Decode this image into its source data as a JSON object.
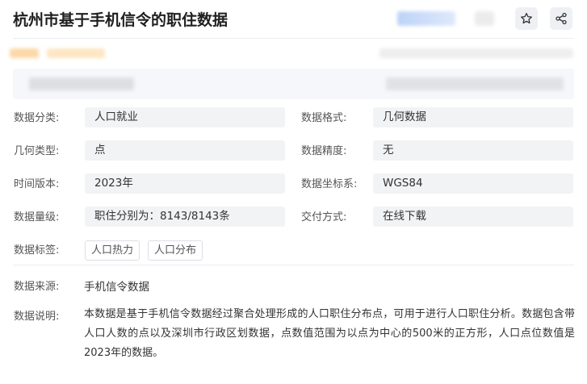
{
  "header": {
    "title": "杭州市基于手机信令的职住数据",
    "favorite_icon": "star-icon",
    "share_icon": "share-icon"
  },
  "fields": {
    "category": {
      "label": "数据分类:",
      "value": "人口就业"
    },
    "format": {
      "label": "数据格式:",
      "value": "几何数据"
    },
    "geometry_type": {
      "label": "几何类型:",
      "value": "点"
    },
    "precision": {
      "label": "数据精度:",
      "value": "无"
    },
    "version": {
      "label": "时间版本:",
      "value": "2023年"
    },
    "crs": {
      "label": "数据坐标系:",
      "value": "WGS84"
    },
    "volume": {
      "label": "数据量级:",
      "value": "职住分别为：8143/8143条"
    },
    "delivery": {
      "label": "交付方式:",
      "value": "在线下载"
    },
    "tags": {
      "label": "数据标签:",
      "items": [
        "人口热力",
        "人口分布"
      ]
    },
    "source": {
      "label": "数据来源:",
      "value": "手机信令数据"
    },
    "description": {
      "label": "数据说明:",
      "value": "本数据是基于手机信令数据经过聚合处理形成的人口职住分布点，可用于进行人口职住分析。数据包含带人口人数的点以及深圳市行政区划数据，点数值范围为以点为中心的500米的正方形，人口点位数值是2023年的数据。"
    }
  }
}
